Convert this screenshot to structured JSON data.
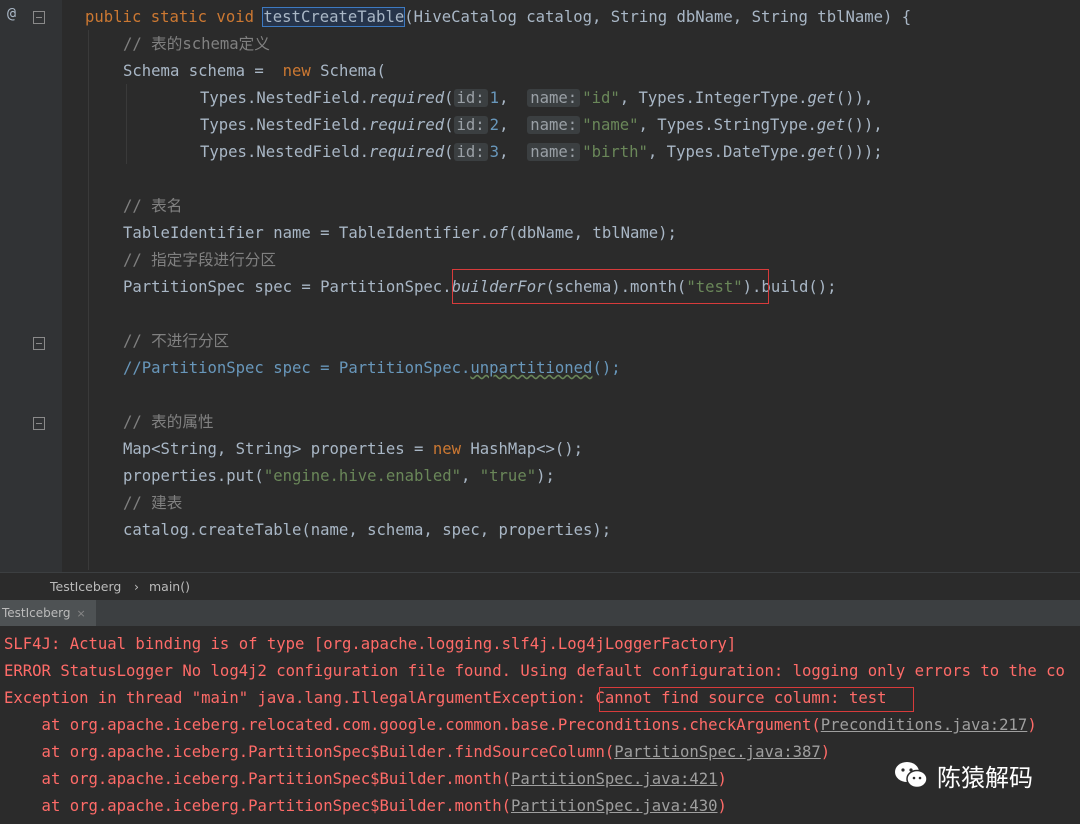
{
  "editor": {
    "gutter_at": "@",
    "lines": {
      "l1": {
        "kw": "public static void ",
        "method": "testCreateTable",
        "rest": "(HiveCatalog catalog, String dbName, String tblName) {"
      },
      "l2": "// 表的schema定义",
      "l3": {
        "a": "Schema schema = ",
        "kw": "new",
        "b": " Schema("
      },
      "l4": {
        "a": "Types.NestedField.",
        "m": "required",
        "p": "(",
        "h1": "id:",
        "n": "1",
        "c": ", ",
        "h2": "name:",
        "s": "\"id\"",
        "r": ", Types.IntegerType.",
        "g": "get",
        "e": "()),"
      },
      "l5": {
        "a": "Types.NestedField.",
        "m": "required",
        "p": "(",
        "h1": "id:",
        "n": "2",
        "c": ", ",
        "h2": "name:",
        "s": "\"name\"",
        "r": ", Types.StringType.",
        "g": "get",
        "e": "()),"
      },
      "l6": {
        "a": "Types.NestedField.",
        "m": "required",
        "p": "(",
        "h1": "id:",
        "n": "3",
        "c": ", ",
        "h2": "name:",
        "s": "\"birth\"",
        "r": ", Types.DateType.",
        "g": "get",
        "e": "()));"
      },
      "l7": "// 表名",
      "l8": {
        "a": "TableIdentifier name = TableIdentifier.",
        "m": "of",
        "b": "(dbName, tblName);"
      },
      "l9": "// 指定字段进行分区",
      "l10": {
        "a": "PartitionSpec spec = PartitionSpec.",
        "m": "builderFor",
        "b": "(schema).month(",
        "s": "\"test\"",
        "c": ").build();"
      },
      "l11": "// 不进行分区",
      "l12": {
        "a": "//PartitionSpec spec = PartitionSpec.",
        "u": "unpartitioned",
        "b": "();"
      },
      "l13": "// 表的属性",
      "l14": {
        "a": "Map<String, String> properties = ",
        "kw": "new",
        "b": " HashMap<>();"
      },
      "l15": {
        "a": "properties.put(",
        "s1": "\"engine.hive.enabled\"",
        "c": ", ",
        "s2": "\"true\"",
        "b": ");"
      },
      "l16": "// 建表",
      "l17": "catalog.createTable(name, schema, spec, properties);"
    }
  },
  "breadcrumb": {
    "class": "TestIceberg",
    "sep": "›",
    "method": "main()"
  },
  "console": {
    "tab_label": "TestIceberg",
    "tab_close": "×",
    "lines": {
      "c1": "SLF4J: Actual binding is of type [org.apache.logging.slf4j.Log4jLoggerFactory]",
      "c2": "ERROR StatusLogger No log4j2 configuration file found. Using default configuration: logging only errors to the co",
      "c3a": "Exception in thread \"main\" java.lang.IllegalArgumentException: ",
      "c3b": "Cannot find source column: test",
      "c4a": "    at org.apache.iceberg.relocated.com.google.common.base.Preconditions.checkArgument(",
      "c4l": "Preconditions.java:217",
      "c4b": ")",
      "c5a": "    at org.apache.iceberg.PartitionSpec$Builder.findSourceColumn(",
      "c5l": "PartitionSpec.java:387",
      "c5b": ")",
      "c6a": "    at org.apache.iceberg.PartitionSpec$Builder.month(",
      "c6l": "PartitionSpec.java:421",
      "c6b": ")",
      "c7a": "    at org.apache.iceberg.PartitionSpec$Builder.month(",
      "c7l": "PartitionSpec.java:430",
      "c7b": ")"
    }
  },
  "watermark": {
    "text": "陈猿解码",
    "icon": "wechat-icon"
  },
  "colors": {
    "keyword": "#cc7832",
    "string": "#6a8759",
    "number": "#6897bb",
    "error": "#ff6b68",
    "highlight_box": "#d83b3b"
  }
}
